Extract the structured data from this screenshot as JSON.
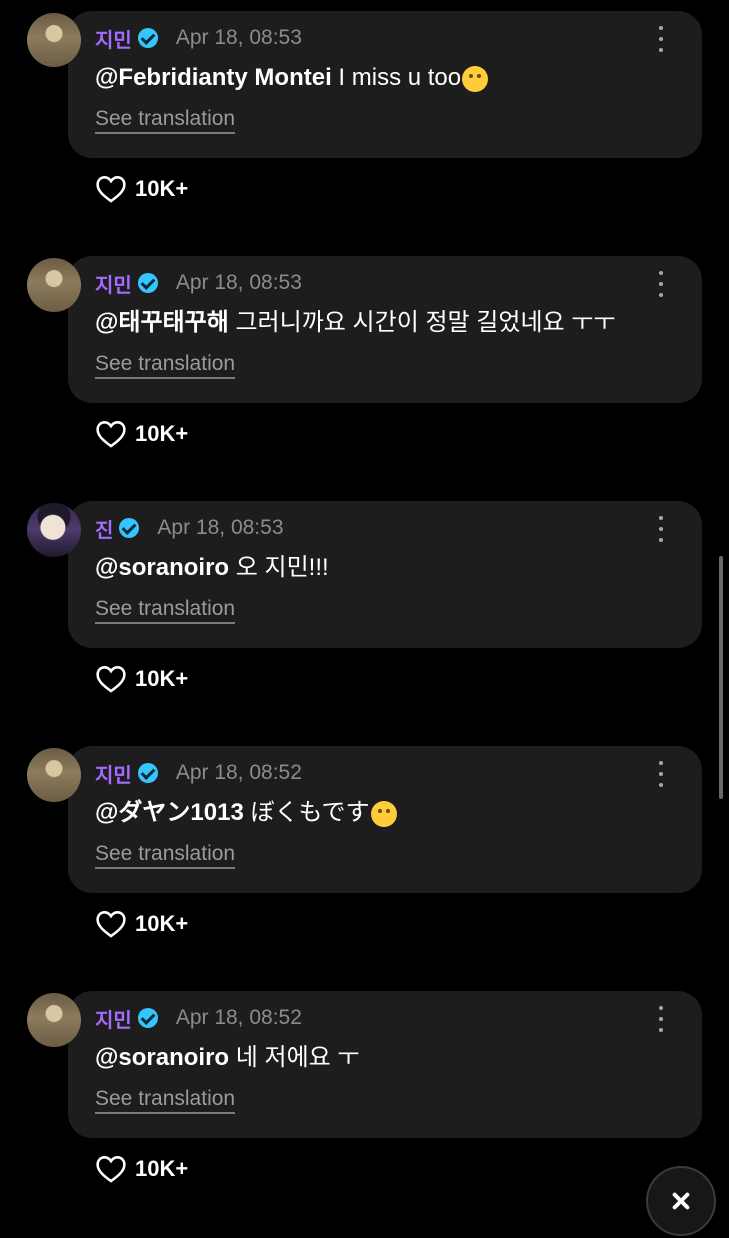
{
  "comments": [
    {
      "author": "지민",
      "verified": true,
      "time": "Apr 18, 08:53",
      "mention": "@Febridianty Montei",
      "text": " I miss u too",
      "emoji": "crying-face",
      "see_translation": "See translation",
      "likes": "10K+"
    },
    {
      "author": "지민",
      "verified": true,
      "time": "Apr 18, 08:53",
      "mention": "@태꾸태꾸해",
      "text": " 그러니까요 시간이 정말 길었네요 ㅜㅜ",
      "see_translation": "See translation",
      "likes": "10K+"
    },
    {
      "author": "진",
      "verified": true,
      "time": "Apr 18, 08:53",
      "mention": "@soranoiro",
      "text": " 오 지민!!!",
      "see_translation": "See translation",
      "likes": "10K+"
    },
    {
      "author": "지민",
      "verified": true,
      "time": "Apr 18, 08:52",
      "mention": "@ダヤン1013",
      "text": " ぼくもです",
      "emoji": "laughing-face",
      "see_translation": "See translation",
      "likes": "10K+"
    },
    {
      "author": "지민",
      "verified": true,
      "time": "Apr 18, 08:52",
      "mention": "@soranoiro",
      "text": " 네 저에요 ㅜ",
      "see_translation": "See translation",
      "likes": "10K+"
    }
  ],
  "colors": {
    "background": "#000000",
    "bubble": "#1d1d1d",
    "name": "#a56bff",
    "verified": "#35c5ff",
    "muted": "#8c8c8c"
  },
  "icons": {
    "verified": "verified-badge-icon",
    "more": "more-options-icon",
    "like": "heart-icon",
    "close": "close-icon"
  }
}
